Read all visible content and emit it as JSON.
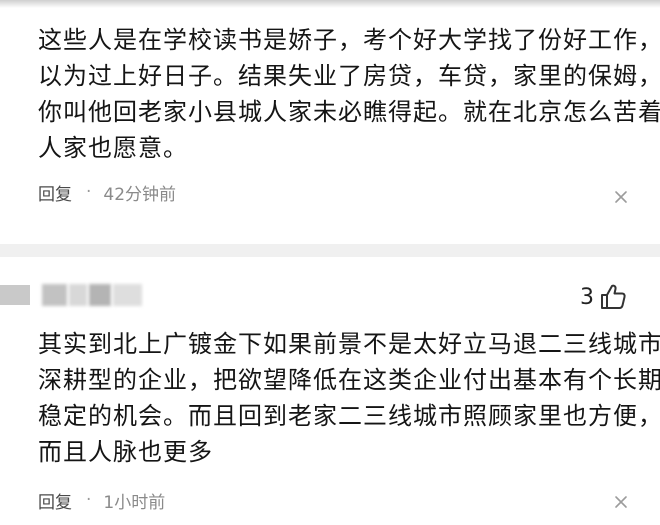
{
  "comments": [
    {
      "lines": [
        "这些人是在学校读书是娇子，考个好大学找了份好工作，",
        "以为过上好日子。结果失业了房贷，车贷，家里的保姆，",
        "你叫他回老家小县城人家未必瞧得起。就在北京怎么苦着",
        "人家也愿意。"
      ],
      "reply_label": "回复",
      "separator": "·",
      "time": "42分钟前"
    },
    {
      "likes": "3",
      "lines": [
        "其实到北上广镀金下如果前景不是太好立马退二三线城市",
        "深耕型的企业，把欲望降低在这类企业付出基本有个长期",
        "稳定的机会。而且回到老家二三线城市照顾家里也方便，",
        "而且人脉也更多"
      ],
      "reply_label": "回复",
      "separator": "·",
      "time": "1小时前"
    }
  ],
  "icons": {
    "close": "close-icon",
    "like": "thumbs-up-icon"
  },
  "colors": {
    "text": "#151515",
    "meta": "#8a8a8a",
    "divider": "#f0f0f0"
  }
}
